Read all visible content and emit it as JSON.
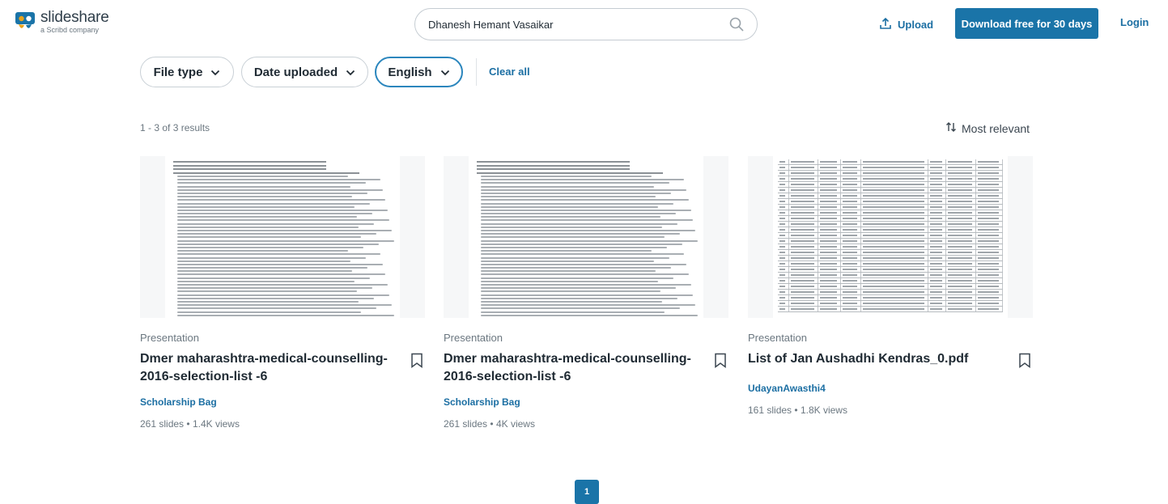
{
  "brand": {
    "name": "slideshare",
    "tagline": "a Scribd company",
    "logo_icon": "slideshare-logo-icon",
    "accent": "#1a74a8"
  },
  "header": {
    "search_value": "Dhanesh Hemant Vasaikar",
    "search_icon": "search-icon",
    "upload_label": "Upload",
    "upload_icon": "upload-icon",
    "download_label": "Download free for 30 days",
    "login_label": "Login"
  },
  "filters": {
    "items": [
      {
        "label": "File type",
        "active": false
      },
      {
        "label": "Date uploaded",
        "active": false
      },
      {
        "label": "English",
        "active": true
      }
    ],
    "clear_all": "Clear all"
  },
  "results": {
    "count_text": "1 - 3 of 3 results",
    "sort_label": "Most relevant",
    "sort_icon": "sort-icon"
  },
  "cards": [
    {
      "type": "Presentation",
      "title": "Dmer maharashtra-medical-counselling-2016-selection-list -6",
      "author": "Scholarship Bag",
      "slides": "261 slides",
      "views": "1.4K views"
    },
    {
      "type": "Presentation",
      "title": "Dmer maharashtra-medical-counselling-2016-selection-list -6",
      "author": "Scholarship Bag",
      "slides": "261 slides",
      "views": "4K views"
    },
    {
      "type": "Presentation",
      "title": "List of Jan Aushadhi Kendras_0.pdf",
      "author": "UdayanAwasthi4",
      "slides": "161 slides",
      "views": "1.8K views"
    }
  ],
  "pagination": {
    "current": "1"
  }
}
